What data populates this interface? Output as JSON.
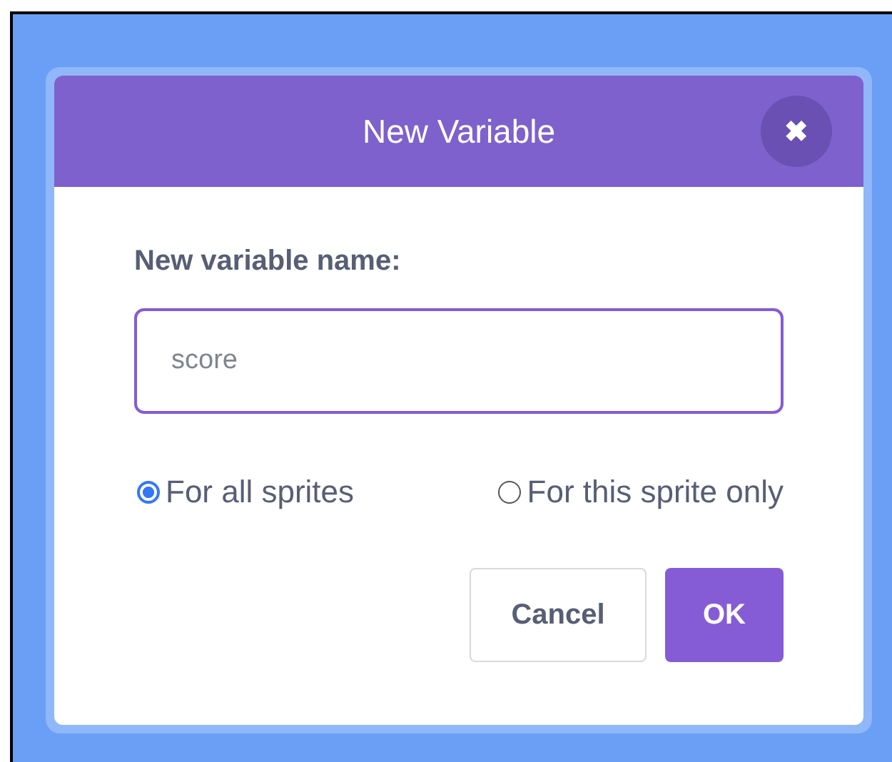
{
  "dialog": {
    "title": "New Variable",
    "close": "✖"
  },
  "field": {
    "label": "New variable name:",
    "placeholder": "score"
  },
  "scope_options": [
    {
      "label": "For all sprites",
      "selected": true
    },
    {
      "label": "For this sprite only",
      "selected": false
    }
  ],
  "buttons": [
    {
      "label": "Cancel",
      "kind": "secondary"
    },
    {
      "label": "OK",
      "kind": "primary"
    }
  ]
}
